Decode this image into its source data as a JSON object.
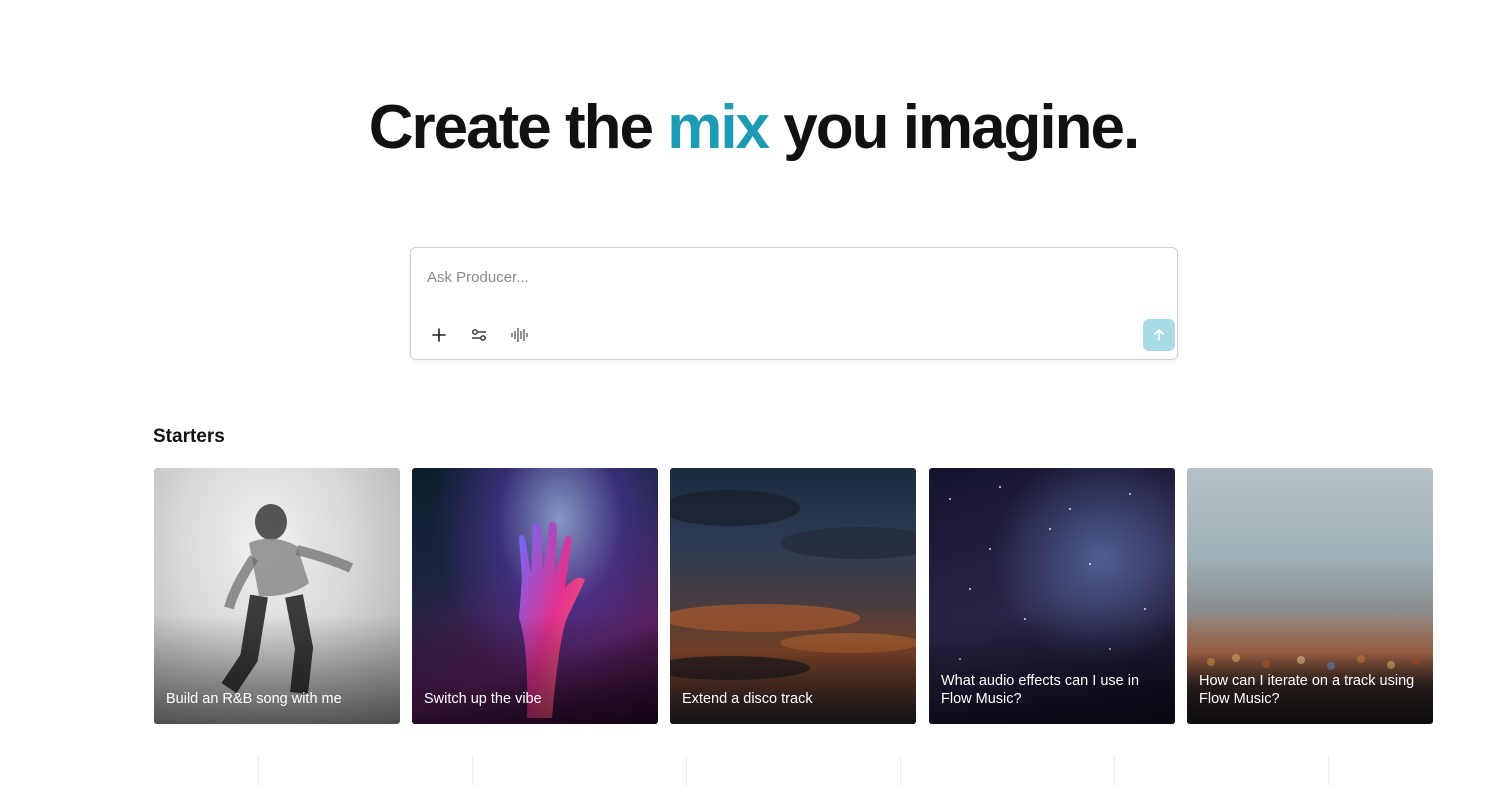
{
  "hero": {
    "before": "Create the ",
    "accent": "mix",
    "after": " you imagine."
  },
  "prompt": {
    "placeholder": "Ask Producer...",
    "value": "",
    "tools": [
      "plus-icon",
      "sliders-icon",
      "waveform-icon"
    ],
    "send_icon": "arrow-up-icon"
  },
  "starters": {
    "title": "Starters",
    "cards": [
      {
        "label": "Build an R&B song with me"
      },
      {
        "label": "Switch up the vibe"
      },
      {
        "label": "Extend a disco track"
      },
      {
        "label": "What audio effects can I use in Flow Music?"
      },
      {
        "label": "How can I iterate on a track using Flow Music?"
      }
    ]
  },
  "colors": {
    "accent": "#1d9bb2",
    "send_button": "#a9dbe6"
  }
}
